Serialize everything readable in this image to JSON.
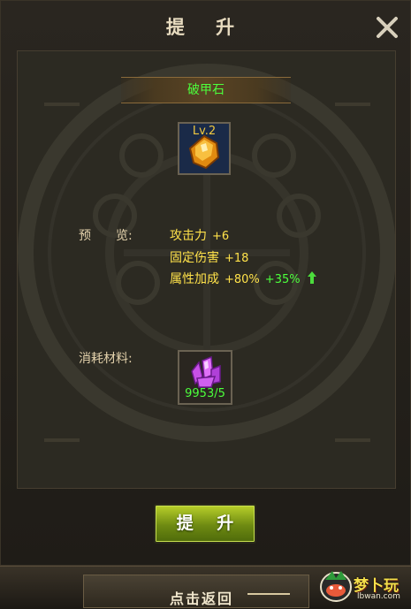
{
  "window": {
    "title": "提 升",
    "close_icon": "close-icon"
  },
  "item": {
    "name": "破甲石",
    "level_badge": "Lv.2",
    "icon": "orange-gem-icon"
  },
  "preview": {
    "label": "预　　览:",
    "stats": [
      {
        "name": "攻击力",
        "value": "+6",
        "bonus": ""
      },
      {
        "name": "固定伤害",
        "value": "+18",
        "bonus": ""
      },
      {
        "name": "属性加成",
        "value": "+80%",
        "bonus": "+35%"
      }
    ],
    "up_arrow_icon": "green-up-arrow-icon"
  },
  "materials": {
    "label": "消耗材料:",
    "icon": "purple-crystal-icon",
    "count": "9953/5"
  },
  "buttons": {
    "upgrade_label": "提 升",
    "back_label": "点击返回"
  },
  "watermark": {
    "name": "梦卜玩",
    "url": "lbwan.com"
  },
  "colors": {
    "item_name": "#4cff3c",
    "stat_text": "#ffe24a",
    "bonus_green": "#4cff3c",
    "button_green": "#8aa81a"
  }
}
